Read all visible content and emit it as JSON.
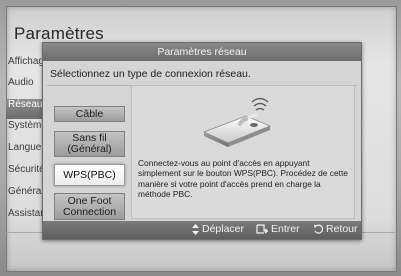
{
  "background": {
    "title": "Paramètres",
    "menu_items": [
      {
        "label": "Affichage",
        "selected": false
      },
      {
        "label": "Audio",
        "selected": false
      },
      {
        "label": "Réseau",
        "selected": true
      },
      {
        "label": "Système",
        "selected": false
      },
      {
        "label": "Langue",
        "selected": false
      },
      {
        "label": "Sécurité",
        "selected": false
      },
      {
        "label": "Général",
        "selected": false
      },
      {
        "label": "Assistance",
        "selected": false
      }
    ]
  },
  "dialog": {
    "title": "Paramètres réseau",
    "instruction": "Sélectionnez un type de connexion réseau.",
    "options": [
      {
        "lines": [
          "Câble"
        ],
        "active": false
      },
      {
        "lines": [
          "Sans fil",
          "(Général)"
        ],
        "active": false
      },
      {
        "lines": [
          "WPS(PBC)"
        ],
        "active": true
      },
      {
        "lines": [
          "One Foot",
          "Connection"
        ],
        "active": false
      }
    ],
    "description": "Connectez-vous au point d'accès en appuyant simplement sur le bouton WPS(PBC). Procédez de cette manière si votre point d'accès prend en charge la méthode PBC.",
    "image_icon": "wps-router-icon"
  },
  "footer": {
    "move": {
      "icon": "up-down-arrows-icon",
      "label": "Déplacer"
    },
    "enter": {
      "icon": "enter-icon",
      "label": "Entrer"
    },
    "back": {
      "icon": "return-icon",
      "label": "Retour"
    }
  },
  "colors": {
    "dialog_bg": "#d5d5d5",
    "title_bar": "#7a7a7a",
    "active_button": "#ffffff"
  }
}
